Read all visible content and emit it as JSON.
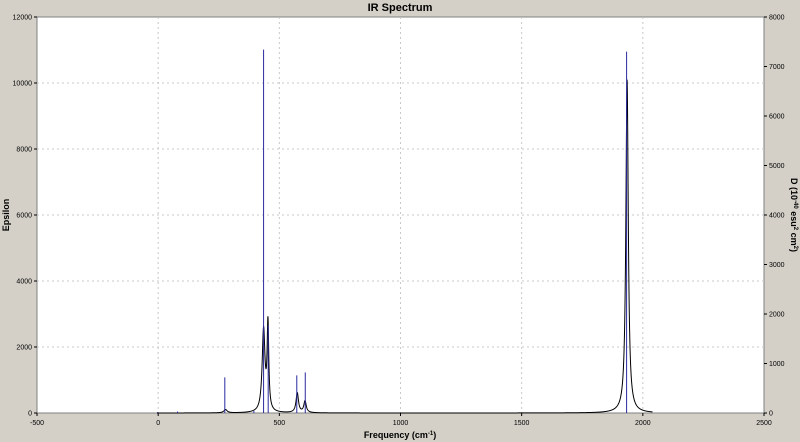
{
  "window": {
    "title": "IR Spectrum"
  },
  "chart_data": {
    "type": "line",
    "title": "IR Spectrum",
    "xlabel": "Frequency (cm",
    "xlabel_sup": "-1",
    "xlabel_end": ")",
    "ylabel": "Epsilon",
    "y2label": "D (10",
    "y2label_sup1": "-40",
    "y2label_mid": " esu",
    "y2label_sup2": "2",
    "y2label_mid2": " cm",
    "y2label_sup3": "2",
    "y2label_end": ")",
    "xlim": [
      -500,
      2500
    ],
    "ylim": [
      0,
      12000
    ],
    "y2lim": [
      0,
      8000
    ],
    "x_ticks": [
      -500,
      0,
      500,
      1000,
      1500,
      2000,
      2500
    ],
    "y_ticks": [
      0,
      2000,
      4000,
      6000,
      8000,
      10000,
      12000
    ],
    "y2_ticks": [
      0,
      1000,
      2000,
      3000,
      4000,
      5000,
      6000,
      7000,
      8000
    ],
    "grid": true,
    "series": [
      {
        "kind": "spectrum",
        "color": "#000000",
        "peaks": [
          {
            "x": 278,
            "height": 100,
            "width": 8
          },
          {
            "x": 435,
            "height": 2500,
            "width": 7
          },
          {
            "x": 453,
            "height": 2600,
            "width": 4
          },
          {
            "x": 574,
            "height": 600,
            "width": 6
          },
          {
            "x": 606,
            "height": 350,
            "width": 6
          },
          {
            "x": 1935,
            "height": 10100,
            "width": 6
          }
        ],
        "x_start": -5,
        "x_end": 2040
      },
      {
        "kind": "sticks",
        "color": "#2a2aa0",
        "sticks": [
          {
            "x": -2,
            "value": 20
          },
          {
            "x": 80,
            "value": 30
          },
          {
            "x": 275,
            "value": 720
          },
          {
            "x": 395,
            "value": 40
          },
          {
            "x": 435,
            "value": 7340
          },
          {
            "x": 454,
            "value": 1770
          },
          {
            "x": 572,
            "value": 760
          },
          {
            "x": 607,
            "value": 820
          },
          {
            "x": 1933,
            "value": 7300
          }
        ]
      }
    ]
  }
}
